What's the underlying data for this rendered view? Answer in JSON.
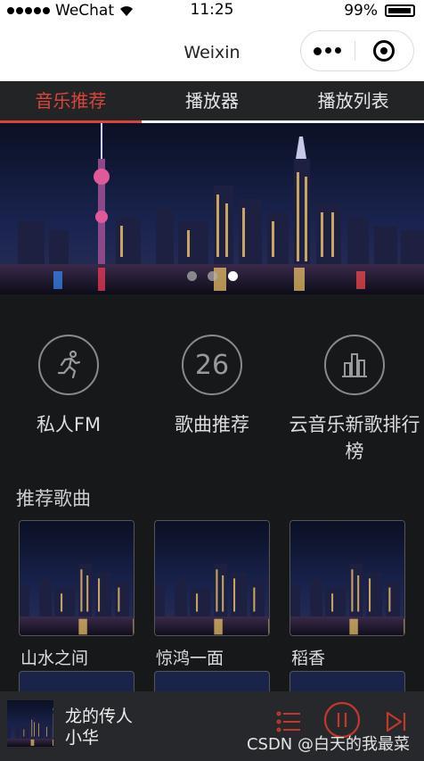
{
  "status_bar": {
    "carrier": "WeChat",
    "time": "11:25",
    "battery": "99%"
  },
  "titlebar": {
    "title": "Weixin"
  },
  "tabs": [
    {
      "label": "音乐推荐",
      "active": true
    },
    {
      "label": "播放器",
      "active": false
    },
    {
      "label": "播放列表",
      "active": false
    }
  ],
  "banner": {
    "dot_count": 3,
    "active_dot": 3
  },
  "features": [
    {
      "label": "私人FM",
      "icon": "running-person-icon"
    },
    {
      "label": "歌曲推荐",
      "icon": "calendar-day-icon",
      "icon_text": "26"
    },
    {
      "label": "云音乐新歌排行榜",
      "icon": "bar-chart-icon"
    }
  ],
  "recommend": {
    "title": "推荐歌曲",
    "songs": [
      {
        "name": "山水之间"
      },
      {
        "name": "惊鸿一面"
      },
      {
        "name": "稻香"
      }
    ]
  },
  "player": {
    "song": "龙的传人",
    "artist": "小华",
    "controls": [
      "playlist-icon",
      "pause-icon",
      "next-icon"
    ],
    "accent": "#d8453c"
  },
  "watermark": "CSDN @白天的我最菜",
  "colors": {
    "accent": "#d8453c",
    "background": "#17181a",
    "tabbar": "#222426"
  }
}
